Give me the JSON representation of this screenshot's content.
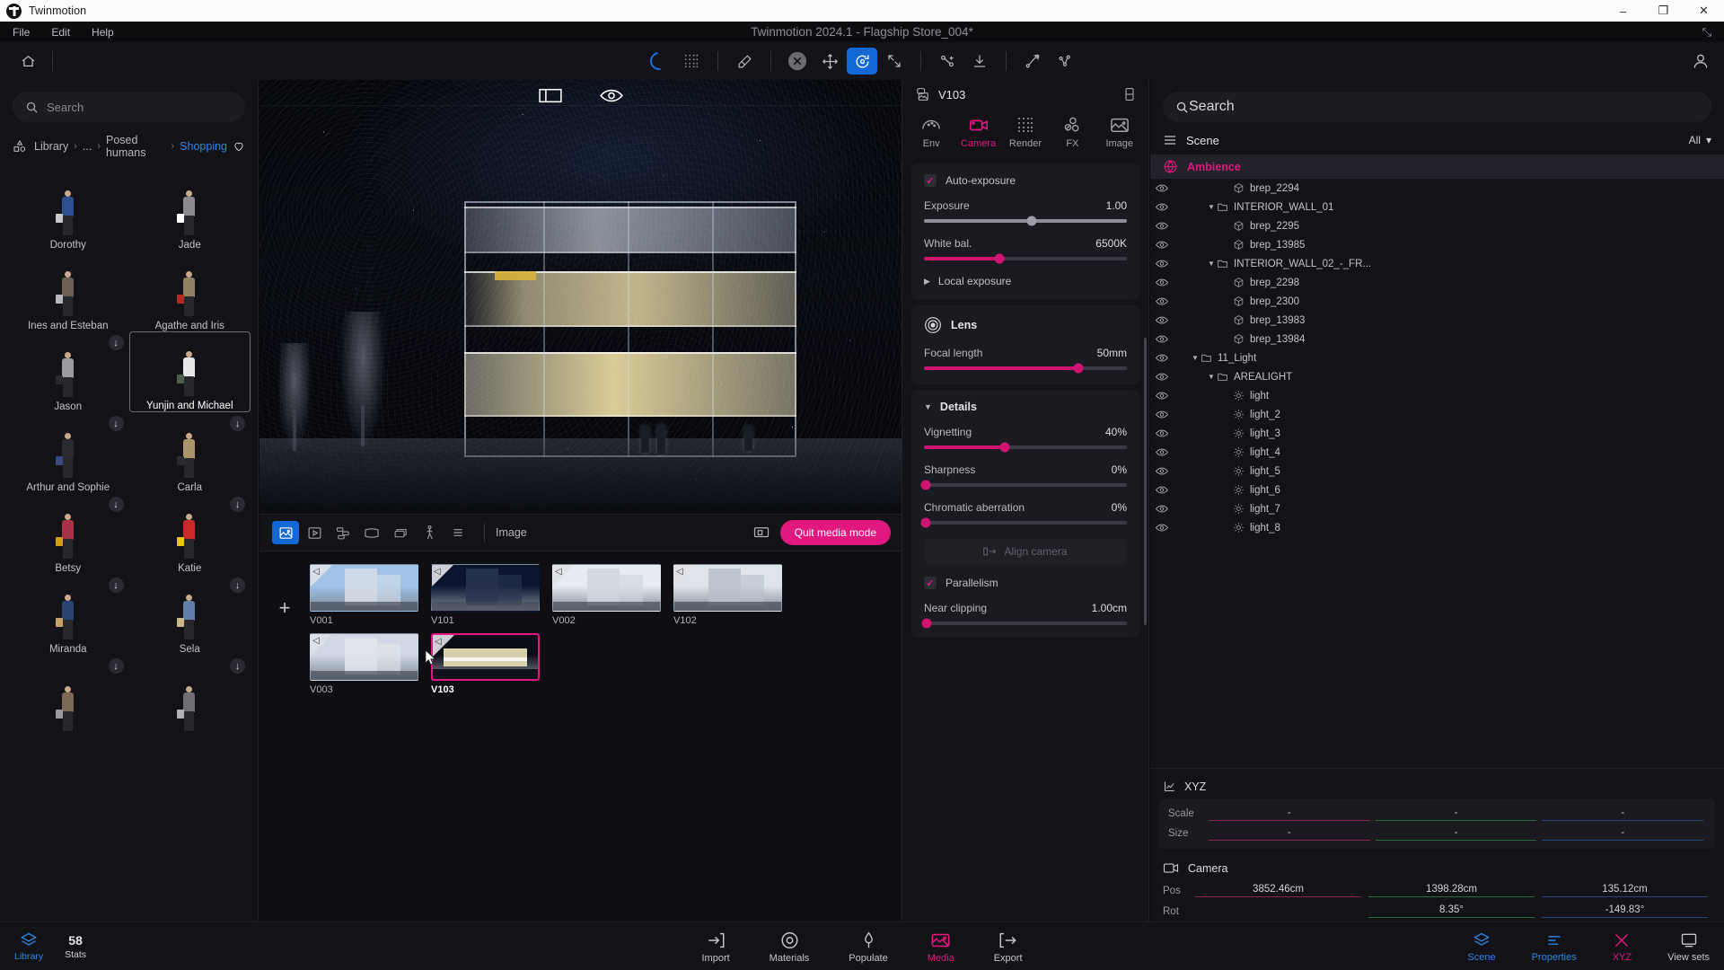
{
  "window": {
    "app_name": "Twinmotion",
    "document_title": "Twinmotion 2024.1 - Flagship Store_004*",
    "minimize": "–",
    "maximize": "❐",
    "close": "✕",
    "expand": "⤡"
  },
  "menubar": {
    "items": [
      "File",
      "Edit",
      "Help"
    ]
  },
  "toolbar": {
    "home_icon": "home-icon",
    "icons": [
      {
        "name": "loading-spinner-icon",
        "state": "spinner"
      },
      {
        "name": "dither-grid-icon",
        "state": "normal"
      },
      {
        "name": "eyedropper-icon",
        "state": "normal"
      },
      {
        "name": "cancel-icon",
        "state": "disabled"
      },
      {
        "name": "move-tool-icon",
        "state": "normal"
      },
      {
        "name": "rotate-tool-icon",
        "state": "active"
      },
      {
        "name": "scale-tool-icon",
        "state": "normal"
      },
      {
        "name": "pivot-tool-icon",
        "state": "normal"
      },
      {
        "name": "drop-to-ground-icon",
        "state": "normal"
      },
      {
        "name": "path-tool-icon",
        "state": "normal"
      },
      {
        "name": "scatter-tool-icon",
        "state": "normal"
      }
    ],
    "user_icon": "user-account-icon"
  },
  "library": {
    "search": {
      "placeholder": "Search",
      "value": ""
    },
    "breadcrumb": {
      "root": "Library",
      "ellipsis": "...",
      "parent": "Posed humans",
      "current": "Shopping",
      "separator": "›"
    },
    "items": [
      {
        "label": "Dorothy",
        "downloadable": false,
        "selected": false,
        "top": "#2e4f8f",
        "bag": "#c9c9cd"
      },
      {
        "label": "Jade",
        "downloadable": false,
        "selected": false,
        "top": "#8a8a90",
        "bag": "#ffffff"
      },
      {
        "label": "Ines and Esteban",
        "downloadable": false,
        "selected": false,
        "top": "#6a6152",
        "bag": "#b9b9bd"
      },
      {
        "label": "Agathe and Iris",
        "downloadable": false,
        "selected": false,
        "top": "#8d8264",
        "bag": "#b02b21"
      },
      {
        "label": "Jason",
        "downloadable": true,
        "selected": false,
        "top": "#9b9ba2",
        "bag": "#2a2a30"
      },
      {
        "label": "Yunjin and Michael",
        "downloadable": false,
        "selected": true,
        "top": "#e7e7ea",
        "bag": "#4d5e4a"
      },
      {
        "label": "Arthur and Sophie",
        "downloadable": true,
        "selected": false,
        "top": "#2a2a30",
        "bag": "#3b4a84"
      },
      {
        "label": "Carla",
        "downloadable": true,
        "selected": false,
        "top": "#a9946c",
        "bag": "#2a2a30"
      },
      {
        "label": "Betsy",
        "downloadable": true,
        "selected": false,
        "top": "#a83347",
        "bag": "#d79a23"
      },
      {
        "label": "Katie",
        "downloadable": true,
        "selected": false,
        "top": "#c62a2a",
        "bag": "#e8c21d"
      },
      {
        "label": "Miranda",
        "downloadable": true,
        "selected": false,
        "top": "#2b4372",
        "bag": "#c6a368"
      },
      {
        "label": "Sela",
        "downloadable": true,
        "selected": false,
        "top": "#5f7fa8",
        "bag": "#cbb88a"
      },
      {
        "label": "",
        "downloadable": true,
        "selected": false,
        "top": "#7a6a55",
        "bag": "#9a9aa0"
      },
      {
        "label": "",
        "downloadable": true,
        "selected": false,
        "top": "#6d6d74",
        "bag": "#b0b0b6"
      }
    ]
  },
  "viewport": {
    "overlay_icons": [
      "aspect-guide-icon",
      "visibility-eye-icon"
    ]
  },
  "mediabar": {
    "icons": [
      {
        "name": "image-media-icon",
        "active": true
      },
      {
        "name": "video-media-icon",
        "active": false
      },
      {
        "name": "panorama-sequence-icon",
        "active": false
      },
      {
        "name": "panorama-media-icon",
        "active": false
      },
      {
        "name": "phasing-media-icon",
        "active": false
      },
      {
        "name": "walkthrough-icon",
        "active": false
      },
      {
        "name": "list-view-icon",
        "active": false
      }
    ],
    "label": "Image",
    "presentation_icon": "presentation-icon",
    "quit_label": "Quit media mode"
  },
  "media": {
    "add_label": "+",
    "thumbnails": [
      {
        "caption": "V001",
        "selected": false,
        "sky": "#9fc4e8",
        "bldg": "#d8dde6",
        "variant": "day-tower"
      },
      {
        "caption": "V101",
        "selected": false,
        "sky": "#0b1530",
        "bldg": "#2a3550",
        "variant": "night-tower"
      },
      {
        "caption": "V002",
        "selected": false,
        "sky": "#e7ecf2",
        "bldg": "#cfd6de",
        "variant": "day-trees"
      },
      {
        "caption": "V102",
        "selected": false,
        "sky": "#dfe4ea",
        "bldg": "#b9c0c9",
        "variant": "grey-facade"
      },
      {
        "caption": "V003",
        "selected": false,
        "sky": "#cfd8e4",
        "bldg": "#e2e6ec",
        "variant": "day-street"
      },
      {
        "caption": "V103",
        "selected": true,
        "sky": "#0a0d16",
        "bldg": "#e8e0b8",
        "variant": "night-store"
      }
    ]
  },
  "properties": {
    "title": "V103",
    "panel_icon": "dock-panel-icon",
    "tabs": [
      {
        "label": "Env",
        "icon": "environment-icon",
        "active": false
      },
      {
        "label": "Camera",
        "icon": "camera-icon",
        "active": true
      },
      {
        "label": "Render",
        "icon": "render-dots-icon",
        "active": false
      },
      {
        "label": "FX",
        "icon": "fx-icon",
        "active": false
      },
      {
        "label": "Image",
        "icon": "image-icon",
        "active": false
      }
    ],
    "exposure_card": {
      "auto_exposure_label": "Auto-exposure",
      "auto_exposure_checked": true,
      "exposure_label": "Exposure",
      "exposure_value": "1.00",
      "exposure_pct": 53,
      "white_balance_label": "White bal.",
      "white_balance_value": "6500K",
      "white_balance_pct": 37,
      "local_exposure_label": "Local exposure",
      "local_exposure_expanded": false
    },
    "lens_card": {
      "title": "Lens",
      "icon": "lens-icon",
      "focal_length_label": "Focal length",
      "focal_length_value": "50mm",
      "focal_length_pct": 76
    },
    "details_card": {
      "title": "Details",
      "expanded": true,
      "vignetting_label": "Vignetting",
      "vignetting_value": "40%",
      "vignetting_pct": 40,
      "sharpness_label": "Sharpness",
      "sharpness_value": "0%",
      "sharpness_pct": 0,
      "chromatic_label": "Chromatic aberration",
      "chromatic_value": "0%",
      "chromatic_pct": 0,
      "align_camera_label": "Align camera",
      "align_camera_icon": "align-camera-icon",
      "parallelism_label": "Parallelism",
      "parallelism_checked": true,
      "near_clipping_label": "Near clipping",
      "near_clipping_value": "1.00cm",
      "near_clipping_pct": 2
    }
  },
  "scene": {
    "search": {
      "placeholder": "Search",
      "value": ""
    },
    "header": {
      "icon": "scene-list-icon",
      "title": "Scene",
      "filter_label": "All",
      "filter_caret": "▾"
    },
    "ambience": {
      "icon": "ambience-icon",
      "label": "Ambience"
    },
    "tree": [
      {
        "label": "brep_2294",
        "depth": 3,
        "type": "mesh",
        "expandable": false,
        "expanded": false
      },
      {
        "label": "INTERIOR_WALL_01",
        "depth": 2,
        "type": "folder",
        "expandable": true,
        "expanded": true
      },
      {
        "label": "brep_2295",
        "depth": 3,
        "type": "mesh",
        "expandable": false,
        "expanded": false
      },
      {
        "label": "brep_13985",
        "depth": 3,
        "type": "mesh",
        "expandable": false,
        "expanded": false
      },
      {
        "label": "INTERIOR_WALL_02_-_FR...",
        "depth": 2,
        "type": "folder",
        "expandable": true,
        "expanded": true
      },
      {
        "label": "brep_2298",
        "depth": 3,
        "type": "mesh",
        "expandable": false,
        "expanded": false
      },
      {
        "label": "brep_2300",
        "depth": 3,
        "type": "mesh",
        "expandable": false,
        "expanded": false
      },
      {
        "label": "brep_13983",
        "depth": 3,
        "type": "mesh",
        "expandable": false,
        "expanded": false
      },
      {
        "label": "brep_13984",
        "depth": 3,
        "type": "mesh",
        "expandable": false,
        "expanded": false
      },
      {
        "label": "11_Light",
        "depth": 1,
        "type": "folder",
        "expandable": true,
        "expanded": true
      },
      {
        "label": "AREALIGHT",
        "depth": 2,
        "type": "folder",
        "expandable": true,
        "expanded": true
      },
      {
        "label": "light",
        "depth": 3,
        "type": "light",
        "expandable": false,
        "expanded": false
      },
      {
        "label": "light_2",
        "depth": 3,
        "type": "light",
        "expandable": false,
        "expanded": false
      },
      {
        "label": "light_3",
        "depth": 3,
        "type": "light",
        "expandable": false,
        "expanded": false
      },
      {
        "label": "light_4",
        "depth": 3,
        "type": "light",
        "expandable": false,
        "expanded": false
      },
      {
        "label": "light_5",
        "depth": 3,
        "type": "light",
        "expandable": false,
        "expanded": false
      },
      {
        "label": "light_6",
        "depth": 3,
        "type": "light",
        "expandable": false,
        "expanded": false
      },
      {
        "label": "light_7",
        "depth": 3,
        "type": "light",
        "expandable": false,
        "expanded": false
      },
      {
        "label": "light_8",
        "depth": 3,
        "type": "light",
        "expandable": false,
        "expanded": false
      }
    ],
    "xyz": {
      "icon": "xyz-icon",
      "title": "XYZ",
      "rows": [
        {
          "label": "Scale",
          "x": "-",
          "y": "-",
          "z": "-"
        },
        {
          "label": "Size",
          "x": "-",
          "y": "-",
          "z": "-"
        }
      ]
    },
    "camera": {
      "icon": "camera-box-icon",
      "title": "Camera",
      "pos_label": "Pos",
      "pos": [
        "3852.46cm",
        "1398.28cm",
        "135.12cm"
      ],
      "rot_label": "Rot",
      "rot": [
        "",
        "8.35°",
        "-149.83°"
      ]
    }
  },
  "statusbar": {
    "left": [
      {
        "label": "Library",
        "icon": "library-icon",
        "accent": "#2f86e8"
      },
      {
        "label": "Stats",
        "value": "58",
        "unit": "%",
        "icon": "stats-icon",
        "accent": "#d2d2d8"
      }
    ],
    "center": [
      {
        "label": "Import",
        "icon": "import-icon",
        "active": false
      },
      {
        "label": "Materials",
        "icon": "materials-icon",
        "active": false
      },
      {
        "label": "Populate",
        "icon": "populate-icon",
        "active": false
      },
      {
        "label": "Media",
        "icon": "media-icon",
        "active": true
      },
      {
        "label": "Export",
        "icon": "export-icon",
        "active": false
      }
    ],
    "right": [
      {
        "label": "Scene",
        "icon": "scene-icon",
        "accent": "blue"
      },
      {
        "label": "Properties",
        "icon": "properties-icon",
        "accent": "blue"
      },
      {
        "label": "XYZ",
        "icon": "xyz-nav-icon",
        "accent": "pink"
      },
      {
        "label": "View sets",
        "icon": "viewsets-icon",
        "accent": "grey"
      }
    ]
  },
  "colors": {
    "accent_pink": "#e0187f",
    "accent_blue": "#2f86e8",
    "panel_bg": "#131317",
    "card_bg": "#1a1a20",
    "slider_pink": "#d0136f"
  }
}
